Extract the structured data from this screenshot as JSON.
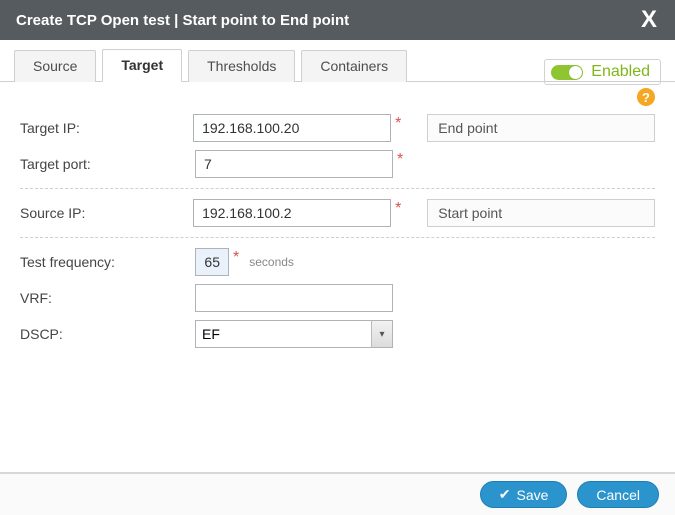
{
  "title": "Create TCP Open test | Start point to End point",
  "tabs": [
    "Source",
    "Target",
    "Thresholds",
    "Containers"
  ],
  "active_tab": "Target",
  "enabled": {
    "label": "Enabled",
    "state": true
  },
  "form": {
    "target_ip": {
      "label": "Target IP:",
      "value": "192.168.100.20",
      "required": true,
      "name": "End point"
    },
    "target_port": {
      "label": "Target port:",
      "value": "7",
      "required": true
    },
    "source_ip": {
      "label": "Source IP:",
      "value": "192.168.100.2",
      "required": true,
      "name": "Start point"
    },
    "frequency": {
      "label": "Test frequency:",
      "value": "65",
      "required": true,
      "unit": "seconds"
    },
    "vrf": {
      "label": "VRF:",
      "value": ""
    },
    "dscp": {
      "label": "DSCP:",
      "value": "EF"
    }
  },
  "buttons": {
    "save": "Save",
    "cancel": "Cancel"
  },
  "icons": {
    "close": "X",
    "help": "?"
  }
}
